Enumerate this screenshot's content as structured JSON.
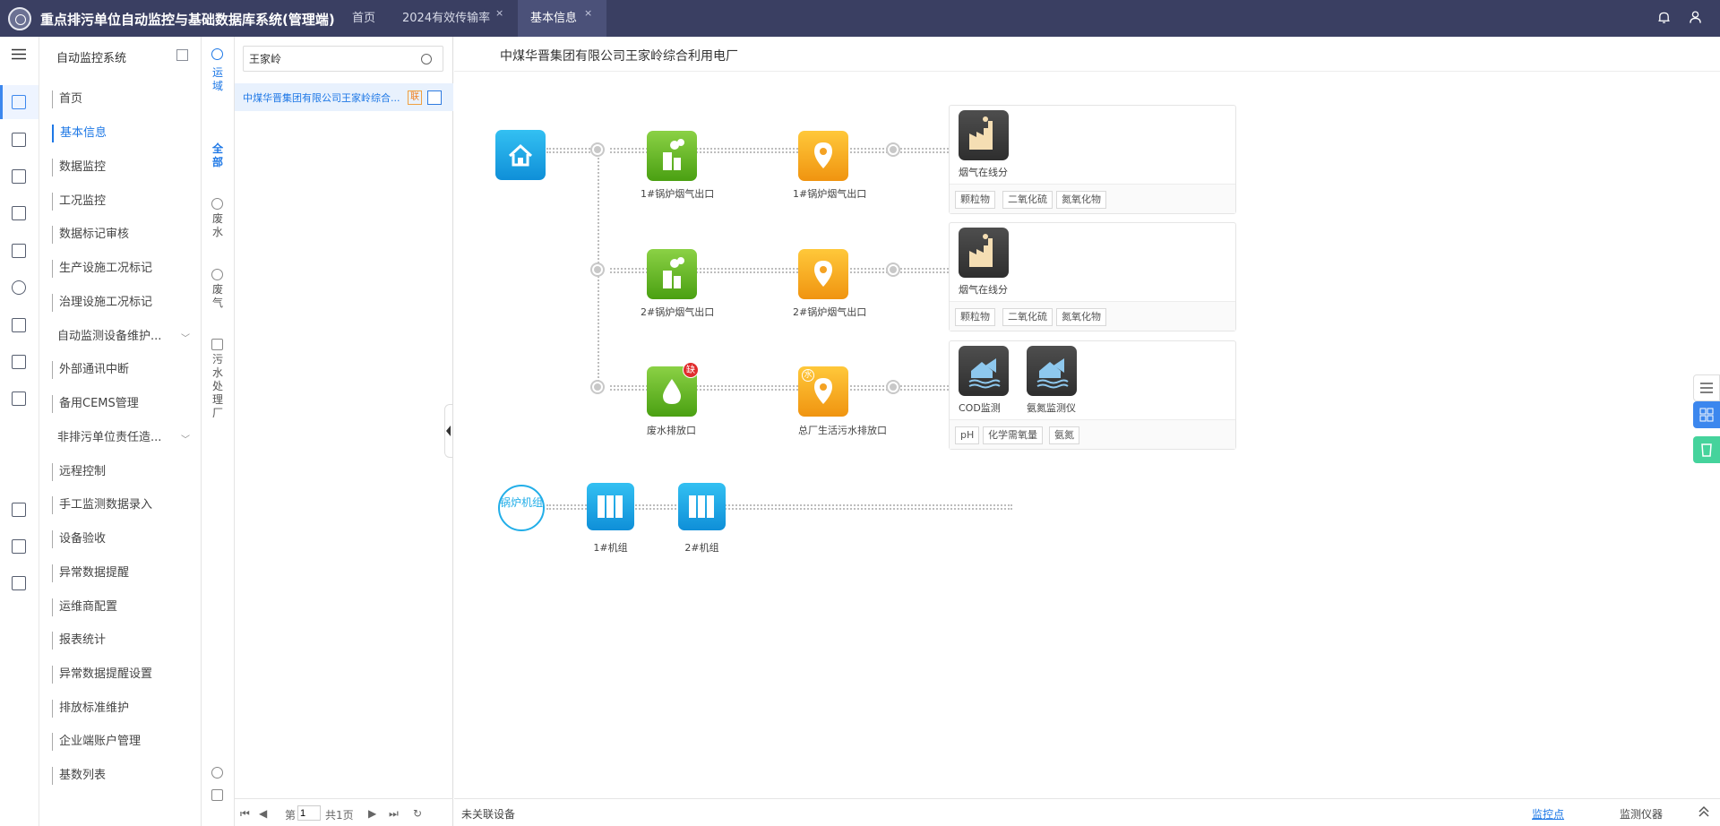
{
  "app": {
    "title": "重点排污单位自动监控与基础数据库系统(管理端)"
  },
  "tabs": [
    {
      "label": "首页"
    },
    {
      "label": "2024有效传输率",
      "close": "×"
    },
    {
      "label": "基本信息",
      "close": "×"
    }
  ],
  "menu": {
    "title": "自动监控系统",
    "items": [
      "首页",
      "基本信息",
      "数据监控",
      "工况监控",
      "数据标记审核",
      "生产设施工况标记",
      "治理设施工况标记",
      "自动监测设备维护...",
      "外部通讯中断",
      "备用CEMS管理",
      "非排污单位责任造...",
      "远程控制",
      "手工监测数据录入",
      "设备验收",
      "异常数据提醒",
      "运维商配置",
      "报表统计",
      "异常数据提醒设置",
      "排放标准维护",
      "企业端账户管理",
      "基数列表"
    ]
  },
  "category": {
    "items": [
      "运域",
      "全部",
      "废水",
      "废气",
      "污水处理厂"
    ]
  },
  "search": {
    "value": "王家岭"
  },
  "list": {
    "rows": [
      {
        "text": "中煤华晋集团有限公司王家岭综合...",
        "badge": "联"
      }
    ]
  },
  "pager": {
    "first": "⏮",
    "prev": "◀",
    "page_prefix": "第",
    "page": "1",
    "total": "共1页",
    "next": "▶",
    "last": "⏭",
    "refresh": "↻"
  },
  "company": {
    "name": "中煤华晋集团有限公司王家岭综合利用电厂"
  },
  "diagram": {
    "outlets": [
      {
        "label": "1#锅炉烟气出口"
      },
      {
        "label": "1#锅炉烟气出口"
      },
      {
        "label": "2#锅炉烟气出口"
      },
      {
        "label": "2#锅炉烟气出口"
      },
      {
        "label": "废水排放口",
        "badge": "缺"
      },
      {
        "label": "总厂生活污水排放口",
        "badge": "水"
      }
    ],
    "cards": [
      {
        "devices": [
          "烟气在线分"
        ],
        "tags": [
          "颗粒物",
          "二氧化硫",
          "氮氧化物"
        ]
      },
      {
        "devices": [
          "烟气在线分"
        ],
        "tags": [
          "颗粒物",
          "二氧化硫",
          "氮氧化物"
        ]
      },
      {
        "devices": [
          "COD监测",
          "氨氮监测仪"
        ],
        "tags": [
          "pH",
          "化学需氧量",
          "氨氮"
        ]
      }
    ],
    "boiler": {
      "label": "锅炉机组",
      "units": [
        "1#机组",
        "2#机组"
      ]
    }
  },
  "bottom": {
    "unlinked": "未关联设备",
    "tab_points": "监控点",
    "tab_instruments": "监测仪器"
  }
}
